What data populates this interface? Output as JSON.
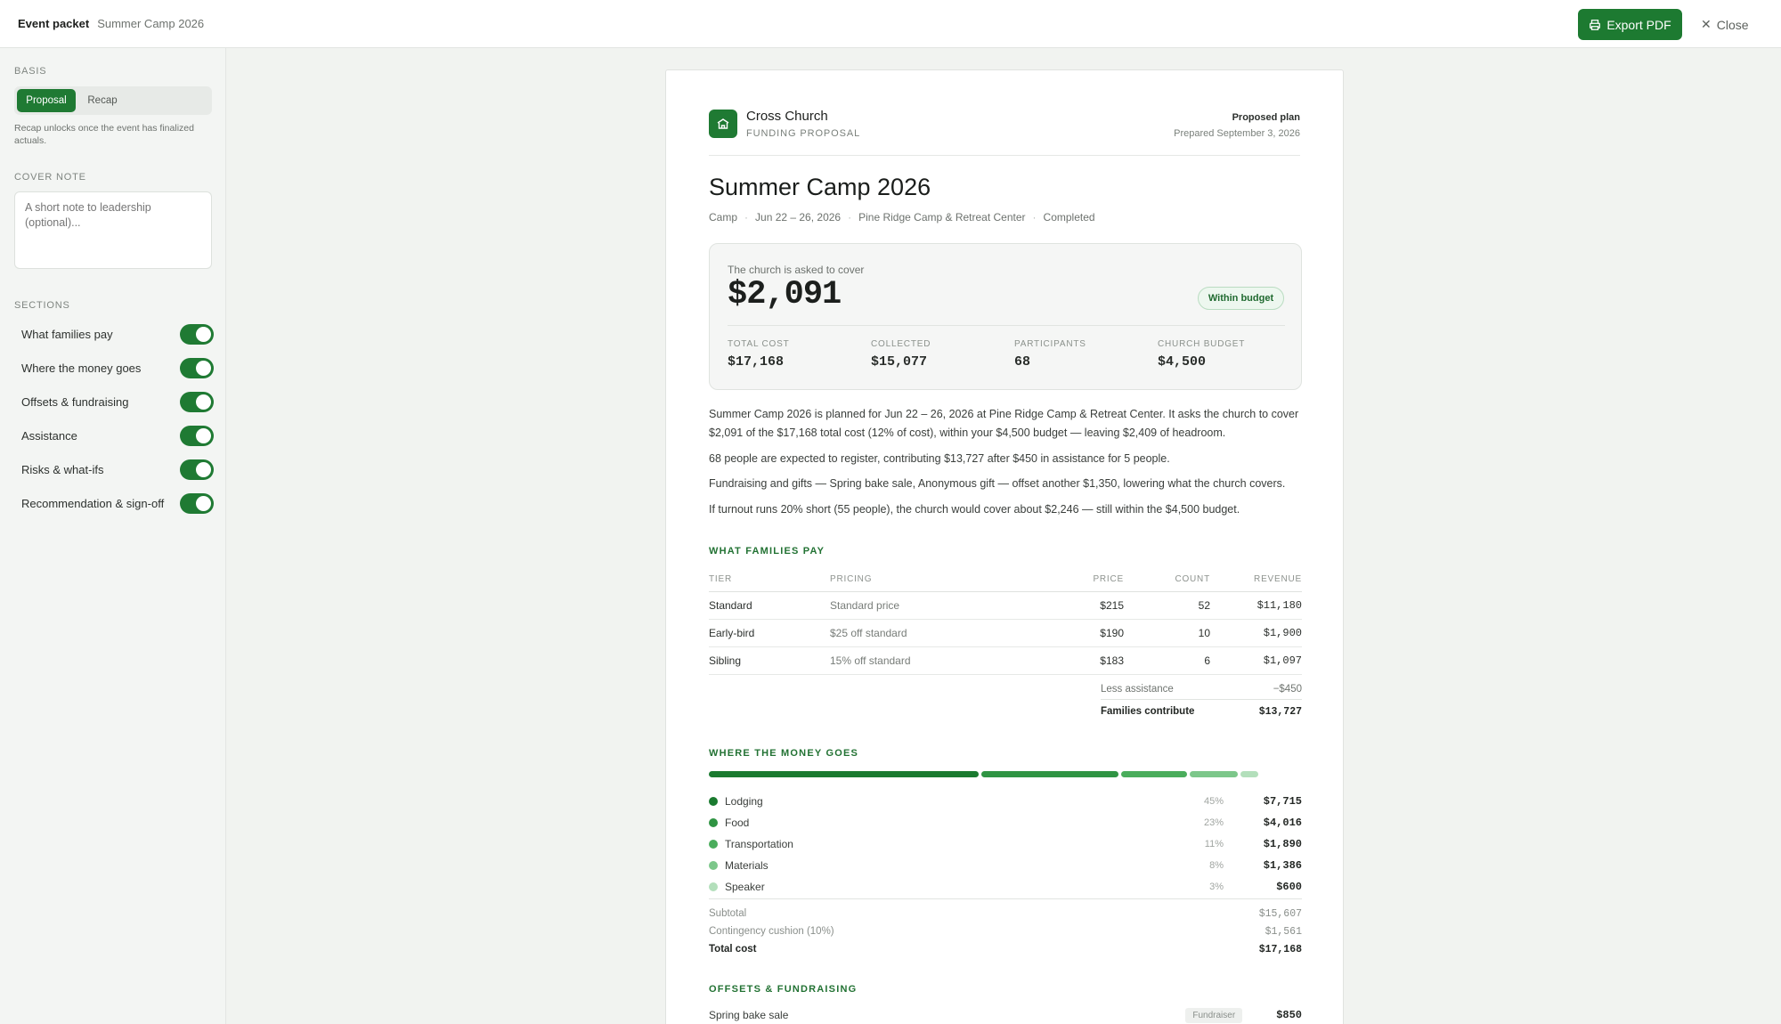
{
  "header": {
    "title": "Event packet",
    "subtitle": "Summer Camp 2026",
    "export_label": "Export PDF",
    "close_label": "Close"
  },
  "sidebar": {
    "basis_label": "BASIS",
    "basis_options": [
      "Proposal",
      "Recap"
    ],
    "basis_hint": "Recap unlocks once the event has finalized actuals.",
    "cover_note_label": "COVER NOTE",
    "cover_note_placeholder": "A short note to leadership (optional)...",
    "sections_label": "SECTIONS",
    "sections": [
      {
        "label": "What families pay",
        "on": true
      },
      {
        "label": "Where the money goes",
        "on": true
      },
      {
        "label": "Offsets & fundraising",
        "on": true
      },
      {
        "label": "Assistance",
        "on": true
      },
      {
        "label": "Risks & what-ifs",
        "on": true
      },
      {
        "label": "Recommendation & sign-off",
        "on": true
      }
    ]
  },
  "doc": {
    "church": "Cross Church",
    "doc_type": "FUNDING PROPOSAL",
    "plan_label": "Proposed plan",
    "prepared": "Prepared September 3, 2026",
    "title": "Summer Camp 2026",
    "meta": [
      "Camp",
      "Jun 22 – 26, 2026",
      "Pine Ridge Camp & Retreat Center",
      "Completed"
    ],
    "ask_label": "The church is asked to cover",
    "ask_value": "$2,091",
    "badge": "Within budget",
    "stats": [
      {
        "label": "TOTAL COST",
        "value": "$17,168"
      },
      {
        "label": "COLLECTED",
        "value": "$15,077"
      },
      {
        "label": "PARTICIPANTS",
        "value": "68"
      },
      {
        "label": "CHURCH BUDGET",
        "value": "$4,500"
      }
    ],
    "paragraphs": [
      "Summer Camp 2026 is planned for Jun 22 – 26, 2026 at Pine Ridge Camp & Retreat Center. It asks the church to cover $2,091 of the $17,168 total cost (12% of cost), within your $4,500 budget — leaving $2,409 of headroom.",
      "68 people are expected to register, contributing $13,727 after $450 in assistance for 5 people.",
      "Fundraising and gifts — Spring bake sale, Anonymous gift — offset another $1,350, lowering what the church covers.",
      "If turnout runs 20% short (55 people), the church would cover about $2,246 — still within the $4,500 budget."
    ],
    "families": {
      "heading": "WHAT FAMILIES PAY",
      "columns": [
        "TIER",
        "PRICING",
        "PRICE",
        "COUNT",
        "REVENUE"
      ],
      "rows": [
        {
          "tier": "Standard",
          "pricing": "Standard price",
          "price": "$215",
          "count": "52",
          "revenue": "$11,180"
        },
        {
          "tier": "Early-bird",
          "pricing": "$25 off standard",
          "price": "$190",
          "count": "10",
          "revenue": "$1,900"
        },
        {
          "tier": "Sibling",
          "pricing": "15% off standard",
          "price": "$183",
          "count": "6",
          "revenue": "$1,097"
        }
      ],
      "less_label": "Less assistance",
      "less_value": "−$450",
      "contrib_label": "Families contribute",
      "contrib_value": "$13,727"
    },
    "money": {
      "heading": "WHERE THE MONEY GOES",
      "items": [
        {
          "name": "Lodging",
          "pct": "45%",
          "amount": "$7,715",
          "share": 45,
          "color": "#1a7a2f"
        },
        {
          "name": "Food",
          "pct": "23%",
          "amount": "$4,016",
          "share": 23,
          "color": "#2f9443"
        },
        {
          "name": "Transportation",
          "pct": "11%",
          "amount": "$1,890",
          "share": 11,
          "color": "#4aad5c"
        },
        {
          "name": "Materials",
          "pct": "8%",
          "amount": "$1,386",
          "share": 8,
          "color": "#7cc78a"
        },
        {
          "name": "Speaker",
          "pct": "3%",
          "amount": "$600",
          "share": 3,
          "color": "#b3dfbb"
        }
      ],
      "subtotal_label": "Subtotal",
      "subtotal": "$15,607",
      "cushion_label": "Contingency cushion (10%)",
      "cushion": "$1,561",
      "total_label": "Total cost",
      "total": "$17,168"
    },
    "offsets": {
      "heading": "OFFSETS & FUNDRAISING",
      "rows": [
        {
          "name": "Spring bake sale",
          "tag": "Fundraiser",
          "amount": "$850"
        }
      ]
    }
  }
}
